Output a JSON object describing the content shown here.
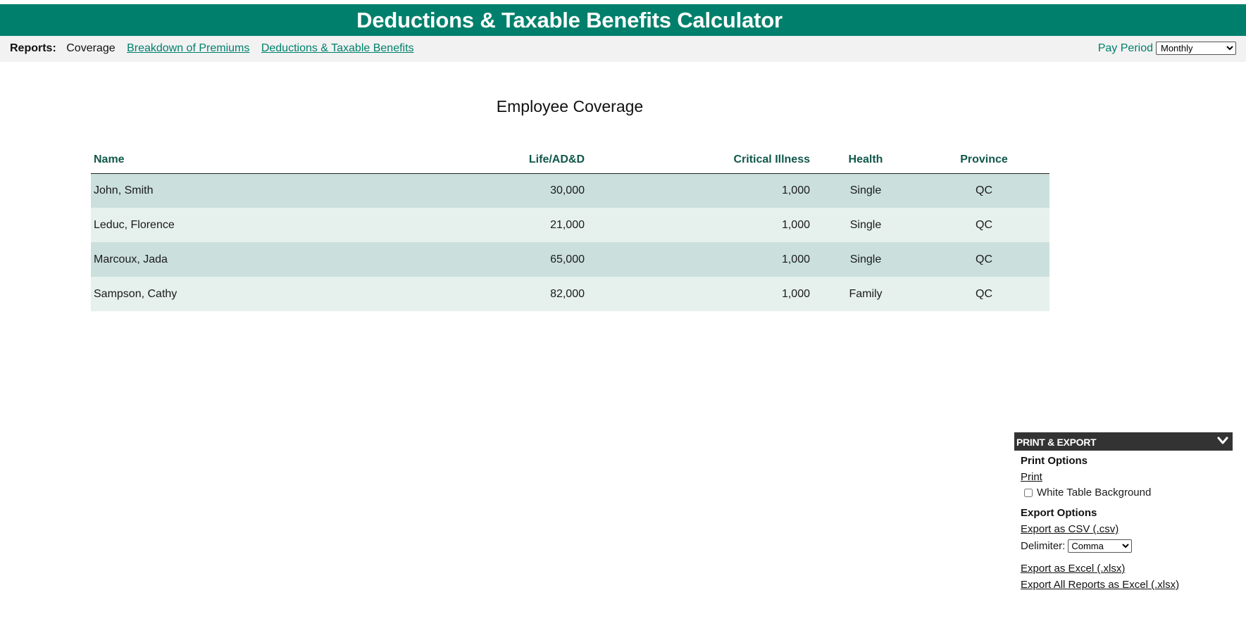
{
  "header": {
    "title": "Deductions & Taxable Benefits Calculator"
  },
  "nav": {
    "reports_label": "Reports:",
    "current": "Coverage",
    "links": [
      "Breakdown of Premiums",
      "Deductions & Taxable Benefits"
    ],
    "pay_period_label": "Pay Period",
    "pay_period_value": "Monthly"
  },
  "report": {
    "title": "Employee Coverage",
    "columns": [
      "Name",
      "Life/AD&D",
      "Critical Illness",
      "Health",
      "Province"
    ],
    "rows": [
      [
        "John, Smith",
        "30,000",
        "1,000",
        "Single",
        "QC"
      ],
      [
        "Leduc, Florence",
        "21,000",
        "1,000",
        "Single",
        "QC"
      ],
      [
        "Marcoux, Jada",
        "65,000",
        "1,000",
        "Single",
        "QC"
      ],
      [
        "Sampson, Cathy",
        "82,000",
        "1,000",
        "Family",
        "QC"
      ]
    ]
  },
  "export_panel": {
    "header": "PRINT & EXPORT",
    "print_options_title": "Print Options",
    "print_link": "Print",
    "white_bg_label": "White Table Background",
    "white_bg_checked": false,
    "export_options_title": "Export Options",
    "csv_link": "Export as CSV (.csv)",
    "delimiter_label": "Delimiter:",
    "delimiter_value": "Comma",
    "excel_link": "Export as Excel (.xlsx)",
    "excel_all_link": "Export All Reports as Excel (.xlsx)"
  },
  "colors": {
    "brand": "#00806c",
    "header_text": "#11574b",
    "row_odd": "#cbe0dc",
    "row_even": "#e6f0ed",
    "panel_header": "#333333"
  }
}
